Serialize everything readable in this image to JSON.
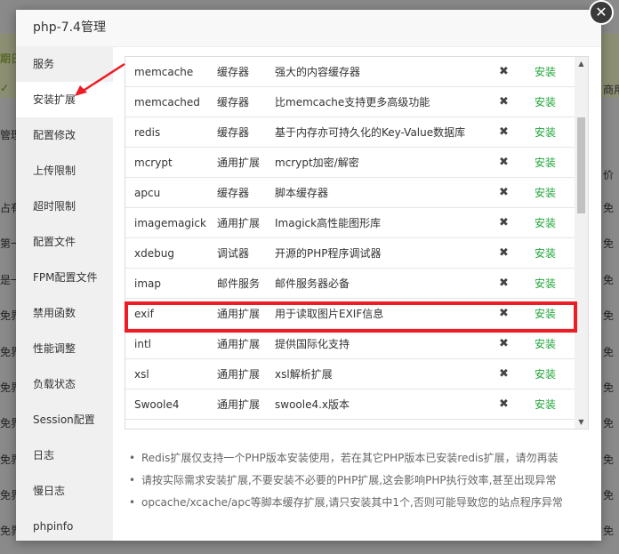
{
  "background_page": {
    "left_fragments": [
      "期日",
      "✓",
      "管理",
      "占有",
      "第一",
      "是一",
      "免界_",
      "免界_",
      "免界_",
      "免界_",
      "免界_",
      "免界_",
      "免界_"
    ],
    "right_fragments": [
      "商用",
      "价",
      "免",
      "免",
      "免",
      "免",
      "免",
      "免",
      "免",
      "免",
      "免",
      "免"
    ]
  },
  "modal": {
    "title": "php-7.4管理",
    "close_icon": "close-icon"
  },
  "sidebar": {
    "items": [
      {
        "label": "服务"
      },
      {
        "label": "安装扩展",
        "active": true
      },
      {
        "label": "配置修改"
      },
      {
        "label": "上传限制"
      },
      {
        "label": "超时限制"
      },
      {
        "label": "配置文件"
      },
      {
        "label": "FPM配置文件"
      },
      {
        "label": "禁用函数"
      },
      {
        "label": "性能调整"
      },
      {
        "label": "负载状态"
      },
      {
        "label": "Session配置"
      },
      {
        "label": "日志"
      },
      {
        "label": "慢日志"
      },
      {
        "label": "phpinfo"
      }
    ]
  },
  "extensions": [
    {
      "name": "memcache",
      "type": "缓存器",
      "desc": "强大的内容缓存器",
      "status": "✖",
      "action": "安装"
    },
    {
      "name": "memcached",
      "type": "缓存器",
      "desc": "比memcache支持更多高级功能",
      "status": "✖",
      "action": "安装"
    },
    {
      "name": "redis",
      "type": "缓存器",
      "desc": "基于内存亦可持久化的Key-Value数据库",
      "status": "✖",
      "action": "安装"
    },
    {
      "name": "mcrypt",
      "type": "通用扩展",
      "desc": "mcrypt加密/解密",
      "status": "✖",
      "action": "安装"
    },
    {
      "name": "apcu",
      "type": "缓存器",
      "desc": "脚本缓存器",
      "status": "✖",
      "action": "安装"
    },
    {
      "name": "imagemagick",
      "type": "通用扩展",
      "desc": "Imagick高性能图形库",
      "status": "✖",
      "action": "安装"
    },
    {
      "name": "xdebug",
      "type": "调试器",
      "desc": "开源的PHP程序调试器",
      "status": "✖",
      "action": "安装"
    },
    {
      "name": "imap",
      "type": "邮件服务",
      "desc": "邮件服务器必备",
      "status": "✖",
      "action": "安装"
    },
    {
      "name": "exif",
      "type": "通用扩展",
      "desc": "用于读取图片EXIF信息",
      "status": "✖",
      "action": "安装"
    },
    {
      "name": "intl",
      "type": "通用扩展",
      "desc": "提供国际化支持",
      "status": "✖",
      "action": "安装"
    },
    {
      "name": "xsl",
      "type": "通用扩展",
      "desc": "xsl解析扩展",
      "status": "✖",
      "action": "安装"
    },
    {
      "name": "Swoole4",
      "type": "通用扩展",
      "desc": "swoole4.x版本",
      "status": "✖",
      "action": "安装"
    }
  ],
  "notes": [
    "Redis扩展仅支持一个PHP版本安装使用，若在其它PHP版本已安装redis扩展，请勿再装",
    "请按实际需求安装扩展,不要安装不必要的PHP扩展,这会影响PHP执行效率,甚至出现异常",
    "opcache/xcache/apc等脚本缓存扩展,请只安装其中1个,否则可能导致您的站点程序异常"
  ],
  "colors": {
    "install_link": "#20a53a",
    "annotation_red": "#ee1c24"
  },
  "scrollbar": {
    "up_icon": "▲",
    "down_icon": "▼"
  }
}
